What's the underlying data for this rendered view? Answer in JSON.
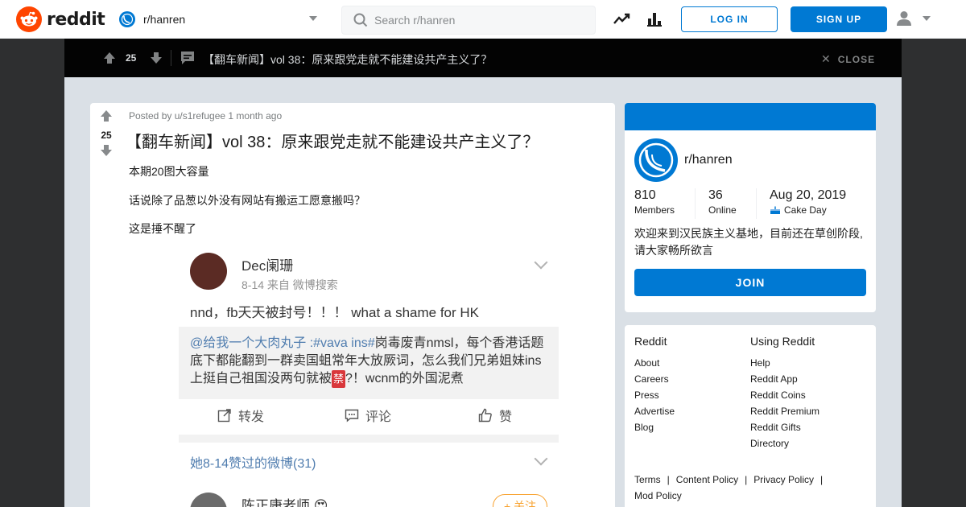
{
  "header": {
    "logo_text": "reddit",
    "subreddit": "r/hanren",
    "search_placeholder": "Search r/hanren",
    "login_label": "LOG IN",
    "signup_label": "SIGN UP"
  },
  "post_bar": {
    "score": "25",
    "title": "【翻车新闻】vol 38：原来跟党走就不能建设共产主义了？",
    "close_label": "CLOSE"
  },
  "post": {
    "score": "25",
    "meta": "Posted by u/s1refugee 1 month ago",
    "title": "【翻车新闻】vol 38：原来跟党走就不能建设共产主义了？",
    "body": [
      "本期20图大容量",
      "话说除了品葱以外没有网站有搬运工愿意搬吗？",
      "这是捶不醒了"
    ]
  },
  "weibo": {
    "user": "Dec阑珊",
    "date": "8-14   来自 微博搜索",
    "text": "nnd，fb天天被封号！！！ what a shame for HK",
    "repost_at": "@给我一个大肉丸子 :#vava ins#",
    "repost_text1": "岗毒废青nmsl，每个香港话题底下都能翻到一群卖国蛆常年大放厥词，怎么我们兄弟姐妹ins上挺自己祖国没两句就被",
    "repost_ban": "禁",
    "repost_text2": "?！wcnm的外国泥煮",
    "act_repost": "转发",
    "act_comment": "评论",
    "act_like": "赞",
    "liked": "她8-14赞过的微博(31)",
    "user2": "陈正康老师 😍",
    "follow": "+ 关注"
  },
  "community": {
    "name": "r/hanren",
    "members_value": "810",
    "members_label": "Members",
    "online_value": "36",
    "online_label": "Online",
    "cake_value": "Aug 20, 2019",
    "cake_label": "Cake Day",
    "description": "欢迎来到汉民族主义基地，目前还在草创阶段,请大家畅所欲言",
    "join_label": "JOIN"
  },
  "links": {
    "col1_title": "Reddit",
    "col1": [
      "About",
      "Careers",
      "Press",
      "Advertise",
      "Blog"
    ],
    "col2_title": "Using Reddit",
    "col2": [
      "Help",
      "Reddit App",
      "Reddit Coins",
      "Reddit Premium",
      "Reddit Gifts",
      "Directory"
    ],
    "policy": [
      "Terms",
      "Content Policy",
      "Privacy Policy",
      "Mod Policy"
    ]
  },
  "colors": {
    "brand": "#ff4500",
    "accent": "#0079d3",
    "overlay": "#030303",
    "page_bg": "#dae0e6"
  }
}
